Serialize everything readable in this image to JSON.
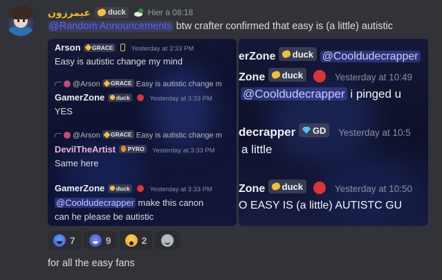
{
  "message": {
    "username": "عيمرزون",
    "tag_label": "duck",
    "timestamp": "Hier à 08:18",
    "mention": "@Random Announcements",
    "text": " btw crafter confirmed that easy is (a little) autistic",
    "followup": "for all the easy fans"
  },
  "left_image": {
    "m1": {
      "name": "Arson",
      "badge": "GRACE",
      "ts": "Yesterday at 3:33 PM",
      "text": "Easy is autistic change my mind"
    },
    "r1": {
      "name": "@Arson",
      "badge": "GRACE",
      "text": "Easy is autistic change m"
    },
    "m2": {
      "name": "GamerZone",
      "badge": "duck",
      "ts": "Yesterday at 3:33 PM",
      "text": "YES"
    },
    "r2": {
      "name": "@Arson",
      "badge": "GRACE",
      "text": "Easy is autistic change m"
    },
    "m3": {
      "name": "DevilTheArtist",
      "badge": "PYRO",
      "ts": "Yesterday at 3:33 PM",
      "text": "Same here"
    },
    "m4": {
      "name": "GamerZone",
      "badge": "duck",
      "ts": "Yesterday at 3:33 PM",
      "mention": "@Cooldudecrapper",
      "text": " make this canon",
      "text2": "can he please be autistic"
    }
  },
  "right_image": {
    "l1": {
      "name": "erZone",
      "badge": "duck",
      "mention": "@Cooldudecrapper"
    },
    "l2": {
      "name": "Zone",
      "badge": "duck",
      "ts": "Yesterday at 10:49"
    },
    "l3": {
      "mention": "@Cooldudecrapper",
      "text": " i pinged u"
    },
    "l4": {
      "name": "decrapper",
      "badge": "GD",
      "ts": "Yesterday at 10:5"
    },
    "l5": {
      "text": "a little"
    },
    "l6": {
      "name": "Zone",
      "badge": "duck",
      "ts": "Yesterday at 10:50"
    },
    "l7": {
      "text": "O EASY IS (a little) AUTISTC GU"
    }
  },
  "reactions": [
    {
      "emoji": "cold-sweat-emoji",
      "count": "7"
    },
    {
      "emoji": "grinning-blue-emoji",
      "count": "9"
    },
    {
      "emoji": "scream-emoji",
      "count": "2"
    }
  ],
  "colors": {
    "username": "#f0b232",
    "role_mention": "#5865f2",
    "background": "#323339"
  }
}
